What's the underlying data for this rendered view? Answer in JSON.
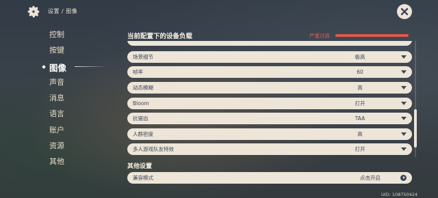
{
  "header": {
    "breadcrumb": "设置 / 图像",
    "settings_icon": "gear-icon",
    "close_icon": "close-icon"
  },
  "sidebar": {
    "items": [
      {
        "label": "控制",
        "active": false
      },
      {
        "label": "按键",
        "active": false
      },
      {
        "label": "图像",
        "active": true
      },
      {
        "label": "声音",
        "active": false
      },
      {
        "label": "消息",
        "active": false
      },
      {
        "label": "语言",
        "active": false
      },
      {
        "label": "账户",
        "active": false
      },
      {
        "label": "资源",
        "active": false
      },
      {
        "label": "其他",
        "active": false
      }
    ]
  },
  "load": {
    "title": "当前配置下的设备负载",
    "status": "严重过高",
    "level_percent": 100,
    "color": "#e2584a"
  },
  "settings": [
    {
      "label": "场景细节",
      "value": "极高"
    },
    {
      "label": "帧率",
      "value": "60"
    },
    {
      "label": "动态模糊",
      "value": "高"
    },
    {
      "label": "Bloom",
      "value": "打开"
    },
    {
      "label": "抗锯齿",
      "value": "TAA"
    },
    {
      "label": "人群密度",
      "value": "高"
    },
    {
      "label": "多人游戏队友特效",
      "value": "打开"
    }
  ],
  "other": {
    "title": "其他设置",
    "compat_label": "兼容模式",
    "compat_value": "点击开启"
  },
  "uid": "UID: 108750424"
}
